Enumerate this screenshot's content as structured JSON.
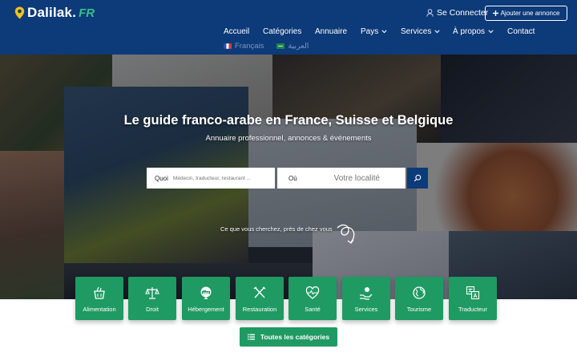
{
  "brand": {
    "name": "Dalilak.",
    "suffix": "FR"
  },
  "header": {
    "login_label": "Se Connecter",
    "add_ad_label": "Ajouter une annonce"
  },
  "nav": {
    "items": [
      {
        "label": "Accueil",
        "has_dropdown": false
      },
      {
        "label": "Catégories",
        "has_dropdown": false
      },
      {
        "label": "Annuaire",
        "has_dropdown": false
      },
      {
        "label": "Pays",
        "has_dropdown": true
      },
      {
        "label": "Services",
        "has_dropdown": true
      },
      {
        "label": "À propos",
        "has_dropdown": true
      },
      {
        "label": "Contact",
        "has_dropdown": false
      }
    ]
  },
  "languages": [
    {
      "label": "Français",
      "flag": "fr-flag-icon"
    },
    {
      "label": "العربية",
      "flag": "sa-flag-icon"
    }
  ],
  "hero": {
    "title": "Le guide franco-arabe en France, Suisse et Belgique",
    "subtitle": "Annuaire professionnel, annonces & événements",
    "hint": "Ce que vous cherchez, près de chez vous"
  },
  "search": {
    "what_label": "Quoi",
    "what_placeholder": "Médecin, traducteur, restaurant ...",
    "where_label": "Où",
    "where_placeholder": "Votre localité"
  },
  "categories": [
    {
      "label": "Alimentation",
      "icon": "grocery-basket-icon"
    },
    {
      "label": "Droit",
      "icon": "scales-icon"
    },
    {
      "label": "Hébergement",
      "icon": "bed-icon"
    },
    {
      "label": "Restauration",
      "icon": "fork-knife-icon"
    },
    {
      "label": "Santé",
      "icon": "heart-pulse-icon"
    },
    {
      "label": "Services",
      "icon": "hand-service-icon"
    },
    {
      "label": "Tourisme",
      "icon": "globe-icon"
    },
    {
      "label": "Traducteur",
      "icon": "translate-icon"
    }
  ],
  "all_categories_label": "Toutes les catégories",
  "colors": {
    "header_bg": "#0d3a78",
    "accent_green": "#1f9a63",
    "logo_pin": "#f2c21b"
  }
}
